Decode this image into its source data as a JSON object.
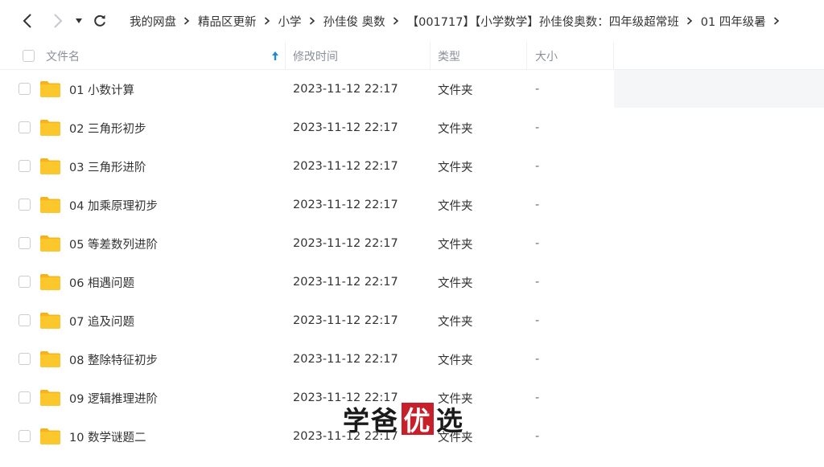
{
  "nav": {
    "back_icon": "chevron-left-icon",
    "forward_icon": "chevron-right-icon",
    "dropdown_icon": "caret-down-icon",
    "refresh_icon": "refresh-icon"
  },
  "breadcrumb": [
    "我的网盘",
    "精品区更新",
    "小学",
    "孙佳俊 奥数",
    "【001717】【小学数学】孙佳俊奥数：四年级超常班",
    "01 四年级暑"
  ],
  "columns": {
    "name": "文件名",
    "modified": "修改时间",
    "type": "类型",
    "size": "大小"
  },
  "files": [
    {
      "name": "01 小数计算",
      "modified": "2023-11-12 22:17",
      "type": "文件夹",
      "size": "-"
    },
    {
      "name": "02 三角形初步",
      "modified": "2023-11-12 22:17",
      "type": "文件夹",
      "size": "-"
    },
    {
      "name": "03 三角形进阶",
      "modified": "2023-11-12 22:17",
      "type": "文件夹",
      "size": "-"
    },
    {
      "name": "04 加乘原理初步",
      "modified": "2023-11-12 22:17",
      "type": "文件夹",
      "size": "-"
    },
    {
      "name": "05 等差数列进阶",
      "modified": "2023-11-12 22:17",
      "type": "文件夹",
      "size": "-"
    },
    {
      "name": "06 相遇问题",
      "modified": "2023-11-12 22:17",
      "type": "文件夹",
      "size": "-"
    },
    {
      "name": "07 追及问题",
      "modified": "2023-11-12 22:17",
      "type": "文件夹",
      "size": "-"
    },
    {
      "name": "08 整除特征初步",
      "modified": "2023-11-12 22:17",
      "type": "文件夹",
      "size": "-"
    },
    {
      "name": "09 逻辑推理进阶",
      "modified": "2023-11-12 22:17",
      "type": "文件夹",
      "size": "-"
    },
    {
      "name": "10 数学谜题二",
      "modified": "2023-11-12 22:17",
      "type": "文件夹",
      "size": "-"
    }
  ],
  "watermark": {
    "before": "学爸",
    "boxed": "优",
    "after": "选"
  },
  "colors": {
    "folder": "#fcc72c",
    "folder_tab": "#f5b419",
    "accent": "#1e88e5",
    "watermark_box": "#c8202a"
  }
}
